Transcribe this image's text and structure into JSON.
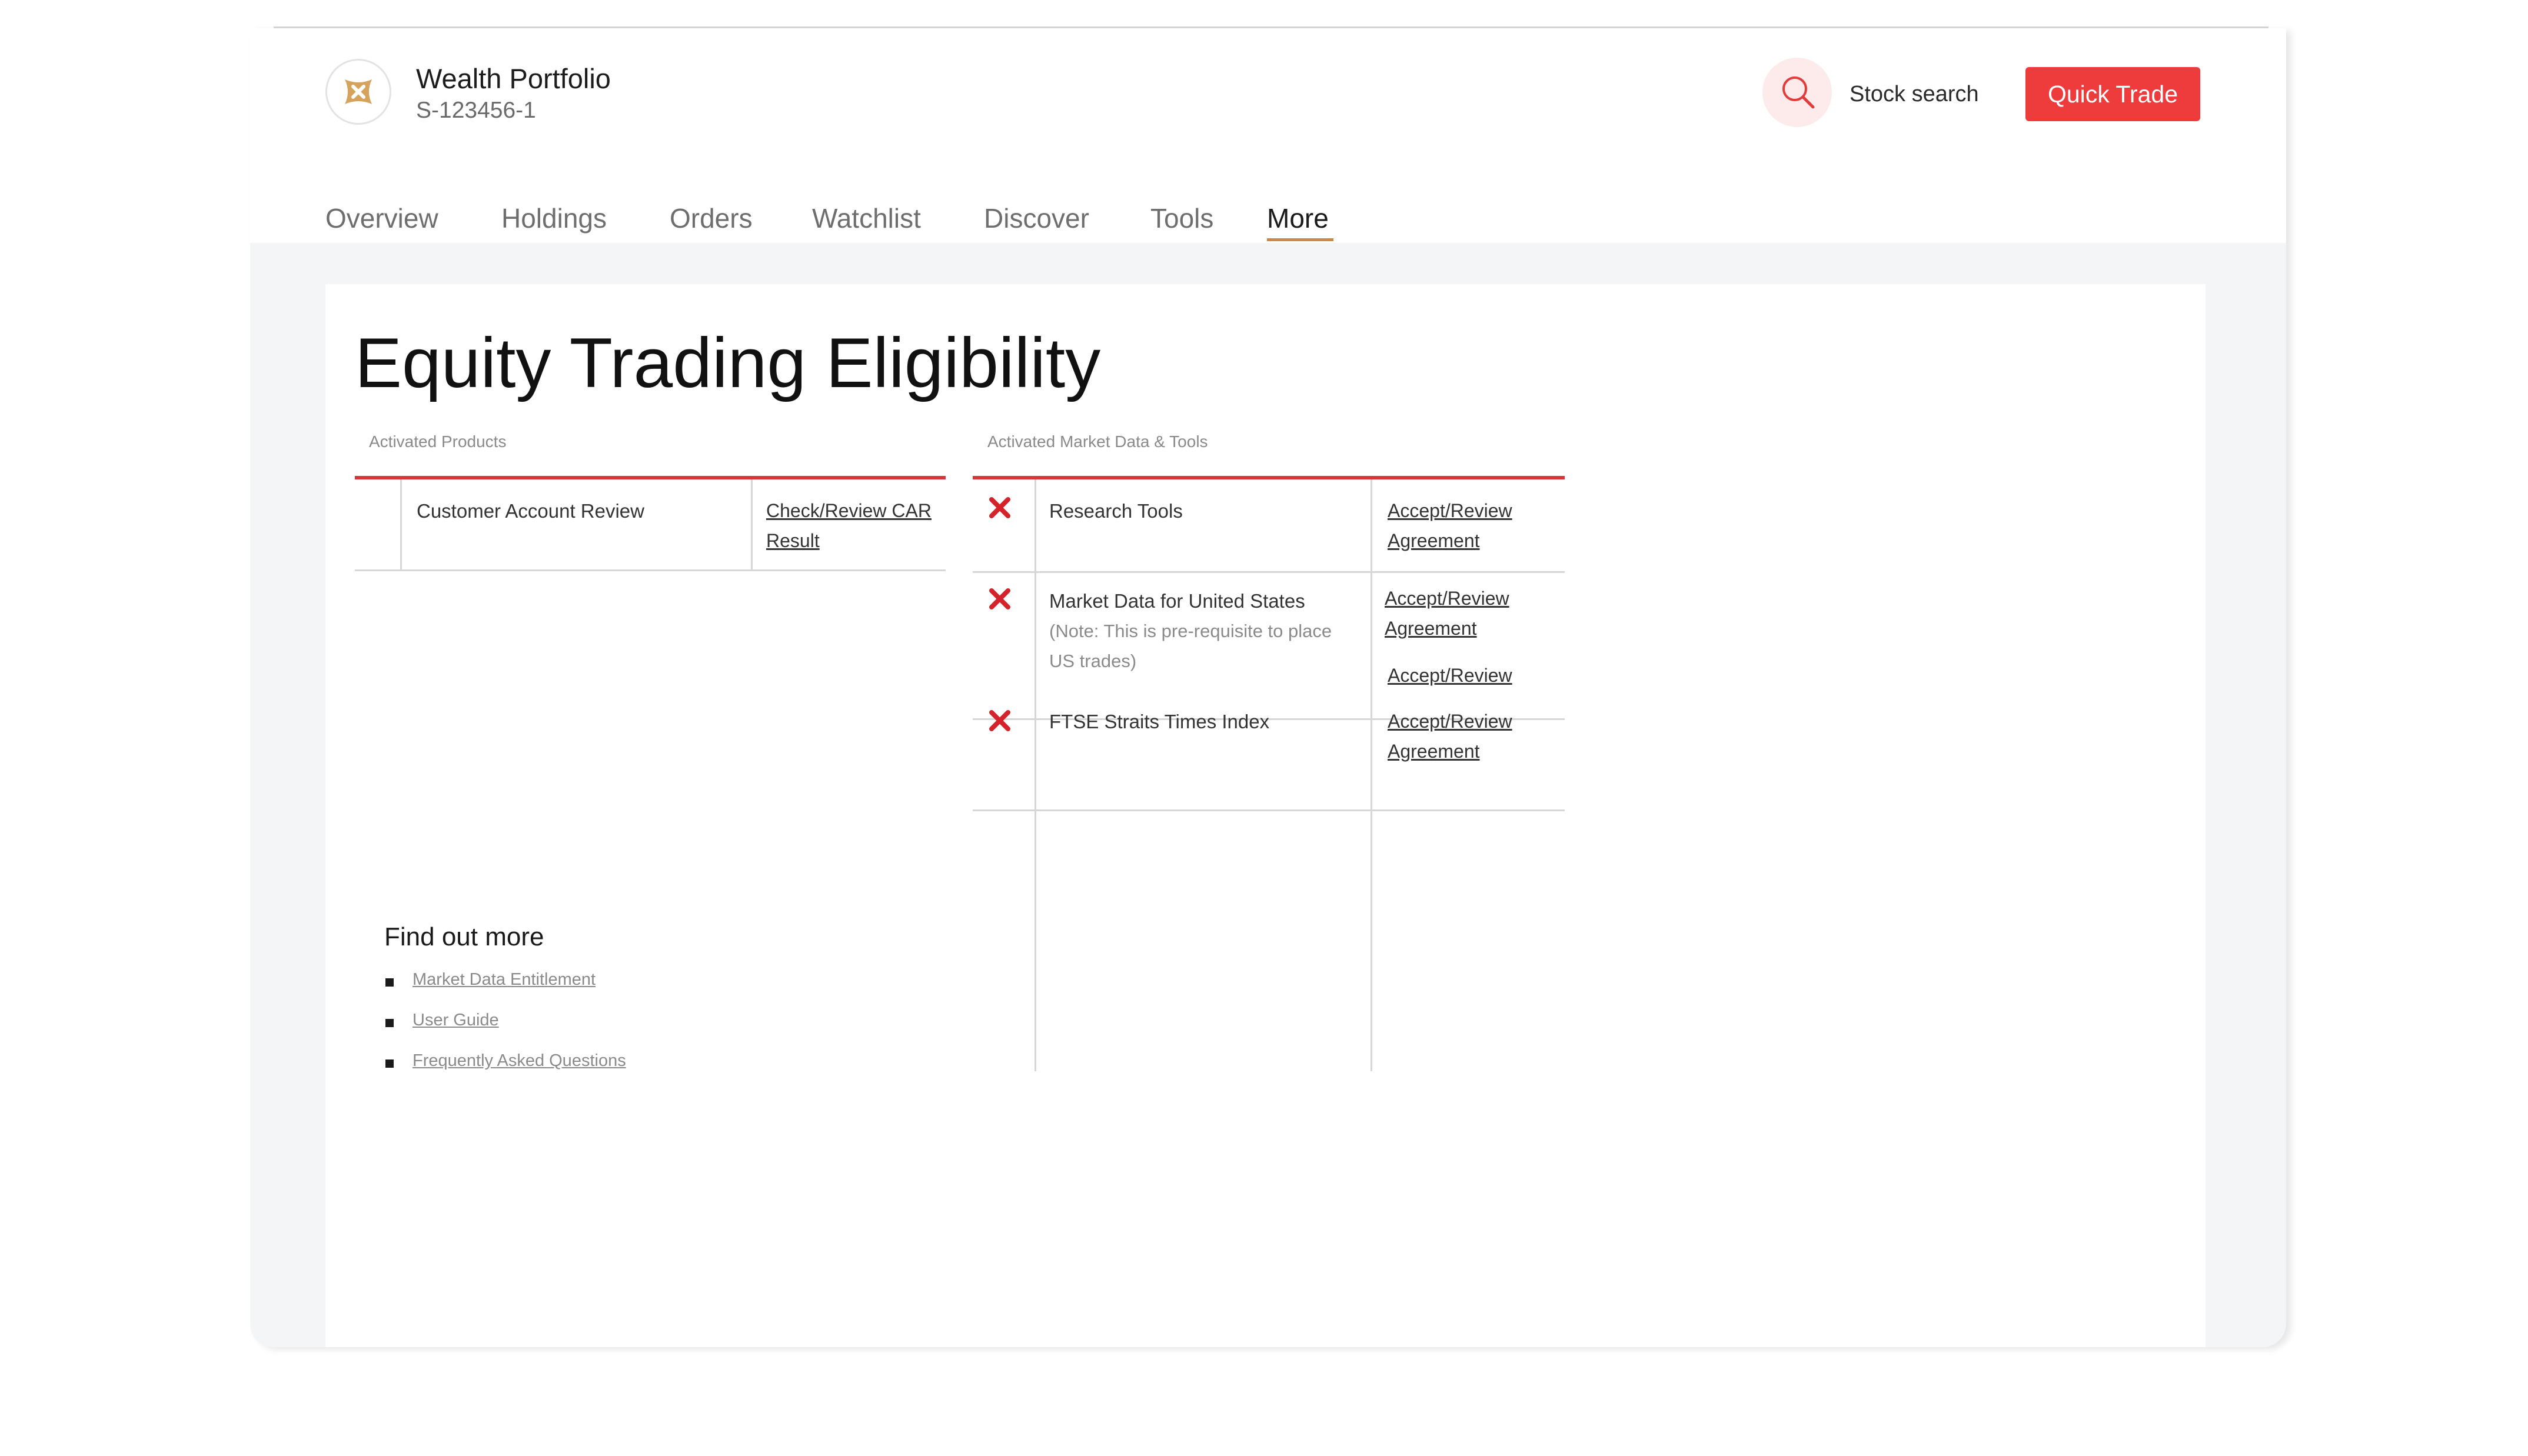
{
  "header": {
    "account_name": "Wealth Portfolio",
    "account_id": "S-123456-1",
    "search_label": "Stock search",
    "quick_trade_label": "Quick Trade",
    "accent_color": "#ee3b3b",
    "tab_indicator_color": "#c9894a",
    "icons": {
      "logo": "brand-logo-icon",
      "search": "search-icon"
    }
  },
  "tabs": [
    {
      "label": "Overview"
    },
    {
      "label": "Holdings"
    },
    {
      "label": "Orders"
    },
    {
      "label": "Watchlist"
    },
    {
      "label": "Discover"
    },
    {
      "label": "Tools"
    },
    {
      "label": "More",
      "active": true
    }
  ],
  "page": {
    "title": "Equity Trading Eligibility"
  },
  "activated_products": {
    "heading": "Activated Products",
    "rows": [
      {
        "name": "Customer Account Review",
        "link_line1": "Check/Review CAR",
        "link_line2": "Result"
      }
    ]
  },
  "market_data": {
    "heading": "Activated Market Data & Tools",
    "status_icon": "cross-icon",
    "status_color": "#d4232a",
    "rows": [
      {
        "name": "Research Tools",
        "link_line1": "Accept/Review",
        "link_line2": "Agreement"
      },
      {
        "name": "Market Data for United States",
        "note_line1": "(Note: This is pre-requisite to place",
        "note_line2": "US trades)",
        "link_line1": "Accept/Review",
        "link_line2": "Agreement",
        "link_line3": "Accept/Review"
      },
      {
        "name": "FTSE Straits Times Index",
        "link_line1": "Accept/Review",
        "link_line2": "Agreement"
      }
    ]
  },
  "find_out_more": {
    "title": "Find out more",
    "links": [
      "Market Data Entitlement",
      "User Guide",
      "Frequently Asked Questions"
    ]
  }
}
